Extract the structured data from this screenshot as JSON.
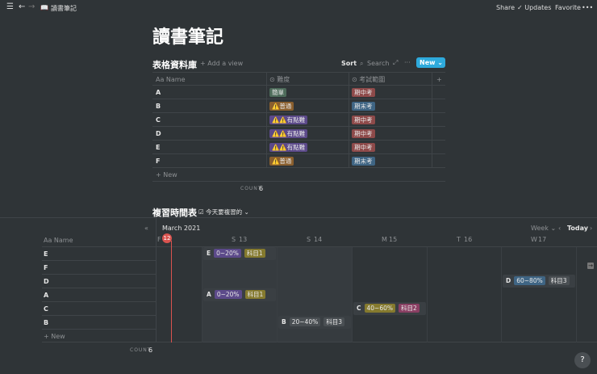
{
  "topbar": {
    "page": "讀書筆記",
    "share": "Share",
    "updates": "✓ Updates",
    "favorite": "Favorite",
    "more": "•••"
  },
  "title": "讀書筆記",
  "table": {
    "title": "表格資料庫",
    "add_view": "+ Add a view",
    "sort": "Sort",
    "search": "Search",
    "new": "New",
    "columns": [
      "Name",
      "難度",
      "考試範圍"
    ],
    "rows": [
      {
        "name": "A",
        "difficulty": "簡單",
        "dcolor": "#4d6b5a",
        "range": "期中考",
        "rcolor": "#8e4a4a"
      },
      {
        "name": "B",
        "difficulty": "⚠️普通",
        "dcolor": "#8a5f2e",
        "range": "期末考",
        "rcolor": "#3f6584"
      },
      {
        "name": "C",
        "difficulty": "⚠️⚠️有點難",
        "dcolor": "#5c4a8a",
        "range": "期中考",
        "rcolor": "#8e4a4a"
      },
      {
        "name": "D",
        "difficulty": "⚠️⚠️有點難",
        "dcolor": "#5c4a8a",
        "range": "期中考",
        "rcolor": "#8e4a4a"
      },
      {
        "name": "E",
        "difficulty": "⚠️⚠️有點難",
        "dcolor": "#5c4a8a",
        "range": "期中考",
        "rcolor": "#8e4a4a"
      },
      {
        "name": "F",
        "difficulty": "⚠️普通",
        "dcolor": "#8a5f2e",
        "range": "期末考",
        "rcolor": "#3f6584"
      }
    ],
    "new_row": "+ New",
    "count_label": "COUNT",
    "count": "6"
  },
  "timeline": {
    "title": "複習時間表",
    "view": "今天要複習的",
    "month": "March 2021",
    "week": "Week",
    "today": "Today",
    "days": [
      {
        "d": "F",
        "n": "12"
      },
      {
        "d": "S",
        "n": "13"
      },
      {
        "d": "S",
        "n": "14"
      },
      {
        "d": "M",
        "n": "15"
      },
      {
        "d": "T",
        "n": "16"
      },
      {
        "d": "W",
        "n": "17"
      }
    ],
    "name_header": "Name",
    "rows": [
      "E",
      "F",
      "D",
      "A",
      "C",
      "B"
    ],
    "new_row": "+ New",
    "count_label": "COUNT",
    "count": "6",
    "cards": [
      {
        "name": "E",
        "pct": "0~20%",
        "pcolor": "#5c4a8a",
        "subj": "科目1",
        "scolor": "#857a2e",
        "row": 0,
        "day": 1
      },
      {
        "name": "D",
        "pct": "60~80%",
        "pcolor": "#3f6584",
        "subj": "科目3",
        "scolor": "#4a4f53",
        "row": 2,
        "day": 5
      },
      {
        "name": "A",
        "pct": "0~20%",
        "pcolor": "#5c4a8a",
        "subj": "科目1",
        "scolor": "#857a2e",
        "row": 3,
        "day": 1
      },
      {
        "name": "C",
        "pct": "40~60%",
        "pcolor": "#857a2e",
        "subj": "科目2",
        "scolor": "#8a3f63",
        "row": 4,
        "day": 3
      },
      {
        "name": "B",
        "pct": "20~40%",
        "pcolor": "#4a4f53",
        "subj": "科目3",
        "scolor": "#4a4f53",
        "row": 5,
        "day": 2
      }
    ]
  },
  "help": "?"
}
